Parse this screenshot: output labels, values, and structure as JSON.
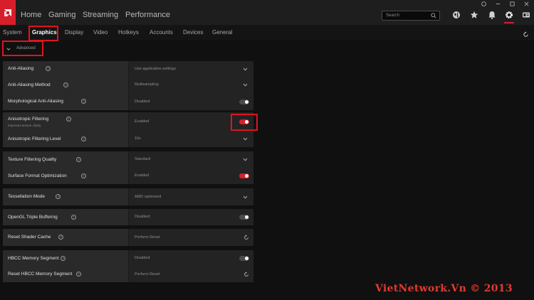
{
  "nav": {
    "items": [
      "Home",
      "Gaming",
      "Streaming",
      "Performance"
    ],
    "search_placeholder": "Search"
  },
  "tabs": [
    "System",
    "Graphics",
    "Display",
    "Video",
    "Hotkeys",
    "Accounts",
    "Devices",
    "General"
  ],
  "active_tab": "Graphics",
  "advanced_label": "Advanced",
  "settings": [
    {
      "label": "Anti-Aliasing",
      "value": "Use application settings",
      "control": "dropdown"
    },
    {
      "label": "Anti-Aliasing Method",
      "value": "Multisampling",
      "control": "dropdown"
    },
    {
      "label": "Morphological Anti-Aliasing",
      "value": "Disabled",
      "control": "toggle-off"
    },
    {
      "label": "Anisotropic Filtering",
      "sublabel": "Improves texture clarity",
      "value": "Enabled",
      "control": "toggle-on"
    },
    {
      "label": "Anisotropic Filtering Level",
      "value": "16x",
      "control": "dropdown"
    },
    {
      "label": "Texture Filtering Quality",
      "value": "Standard",
      "control": "dropdown"
    },
    {
      "label": "Surface Format Optimization",
      "value": "Enabled",
      "control": "toggle-on"
    },
    {
      "label": "Tessellation Mode",
      "value": "AMD optimized",
      "control": "dropdown"
    },
    {
      "label": "OpenGL Triple Buffering",
      "value": "Disabled",
      "control": "toggle-off"
    },
    {
      "label": "Reset Shader Cache",
      "value": "Perform Reset",
      "control": "reset"
    },
    {
      "label": "HBCC Memory Segment",
      "value": "Disabled",
      "control": "toggle-off"
    },
    {
      "label": "Reset HBCC Memory Segment",
      "value": "Perform Reset",
      "control": "reset"
    }
  ],
  "help_glyph": "?",
  "watermark": "VietNetwork.Vn © 2013",
  "colors": {
    "accent": "#d71f2b",
    "annotation": "#e0141e"
  }
}
